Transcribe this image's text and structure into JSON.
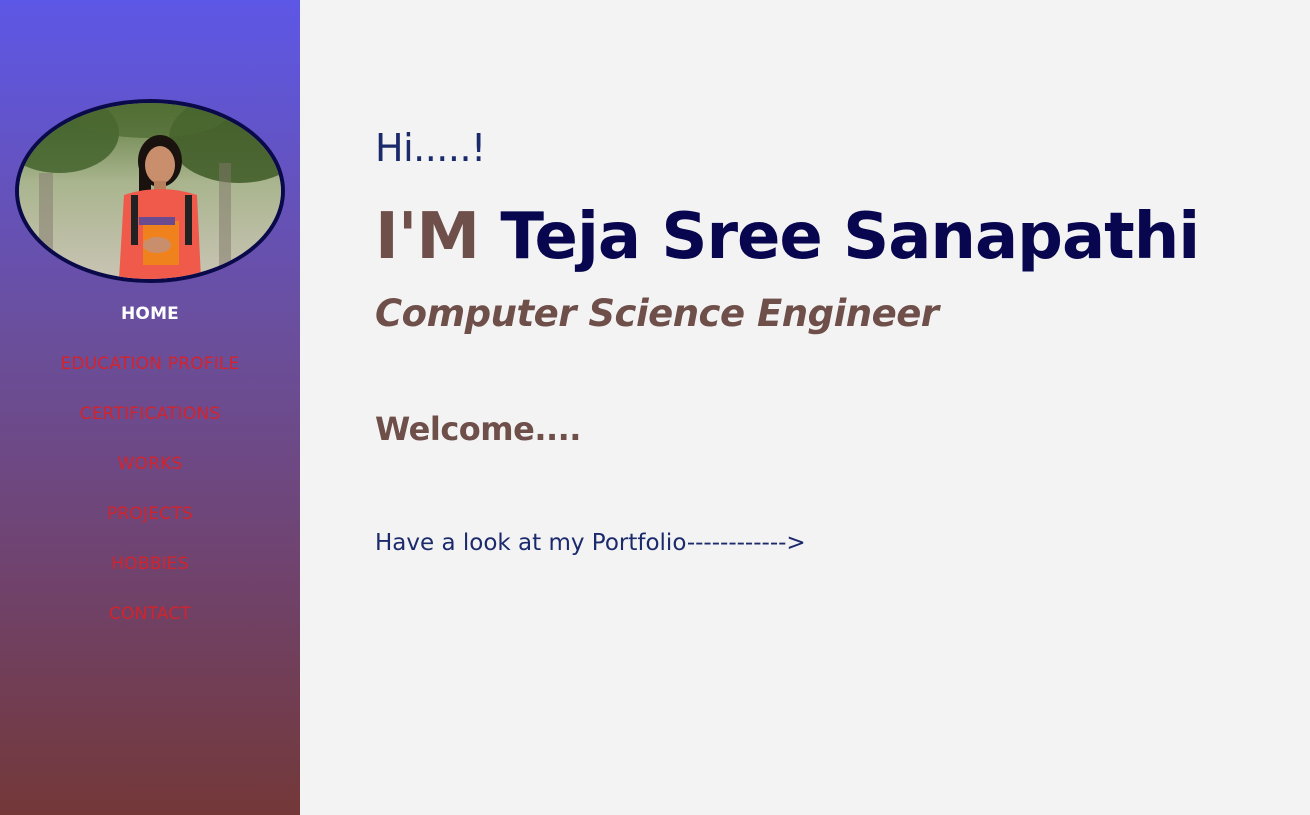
{
  "sidebar": {
    "avatar_alt": "profile photo",
    "nav": [
      {
        "label": "HOME"
      },
      {
        "label": "EDUCATION PROFILE"
      },
      {
        "label": "CERTIFICATIONS"
      },
      {
        "label": "WORKS"
      },
      {
        "label": "PROJECTS"
      },
      {
        "label": "HOBBIES"
      },
      {
        "label": "CONTACT"
      }
    ]
  },
  "main": {
    "greeting": "Hi.....!",
    "name_prefix": "I'M",
    "name": "Teja Sree Sanapathi",
    "role": "Computer Science Engineer",
    "welcome": "Welcome....",
    "portfolio_link": "Have a look at my Portfolio------------>"
  },
  "colors": {
    "sidebar_top": "#5d57e6",
    "sidebar_bottom": "#733838",
    "nav_inactive": "#d3232c",
    "nav_active": "#ffffff",
    "name_dark": "#07064f",
    "accent_brown": "#6e4f49",
    "text_blue": "#1b2a6b",
    "background": "#f3f3f3"
  }
}
